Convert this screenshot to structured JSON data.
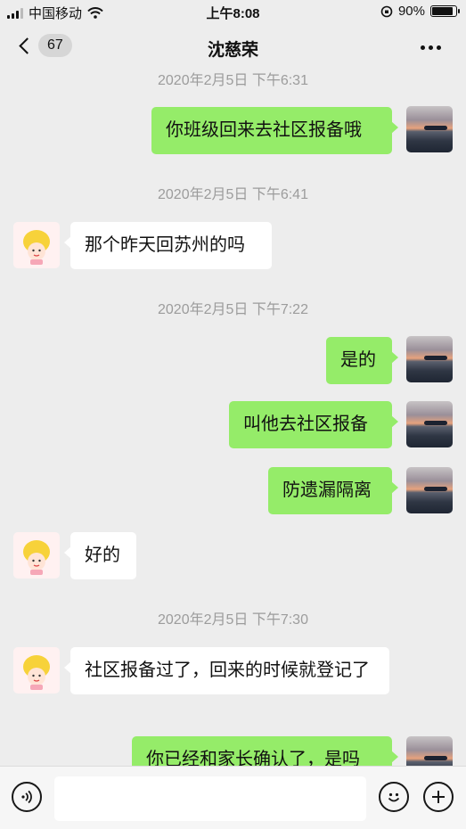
{
  "status": {
    "carrier": "中国移动",
    "time": "上午8:08",
    "battery": "90%",
    "battery_level": 0.9
  },
  "nav": {
    "badge": "67",
    "title": "沈慈荣"
  },
  "messages": [
    {
      "type": "timestamp",
      "text": "2020年2月5日 下午6:31"
    },
    {
      "type": "mine",
      "text": "你班级回来去社区报备哦"
    },
    {
      "type": "timestamp",
      "text": "2020年2月5日 下午6:41"
    },
    {
      "type": "theirs",
      "text": "那个昨天回苏州的吗"
    },
    {
      "type": "timestamp",
      "text": "2020年2月5日 下午7:22"
    },
    {
      "type": "mine",
      "text": "是的"
    },
    {
      "type": "mine",
      "text": "叫他去社区报备"
    },
    {
      "type": "mine",
      "text": "防遗漏隔离"
    },
    {
      "type": "theirs",
      "text": "好的"
    },
    {
      "type": "timestamp",
      "text": "2020年2月5日 下午7:30"
    },
    {
      "type": "theirs",
      "text": "社区报备过了，回来的时候就登记了"
    },
    {
      "type": "mine",
      "text": "你已经和家长确认了，是吗"
    }
  ],
  "icons": {
    "back": "chevron-left-icon",
    "more": "more-dots-icon",
    "voice": "voice-icon",
    "emoji": "emoji-icon",
    "add": "plus-circle-icon"
  },
  "colors": {
    "my_bubble": "#95ec69",
    "their_bubble": "#ffffff",
    "background": "#ededed"
  }
}
